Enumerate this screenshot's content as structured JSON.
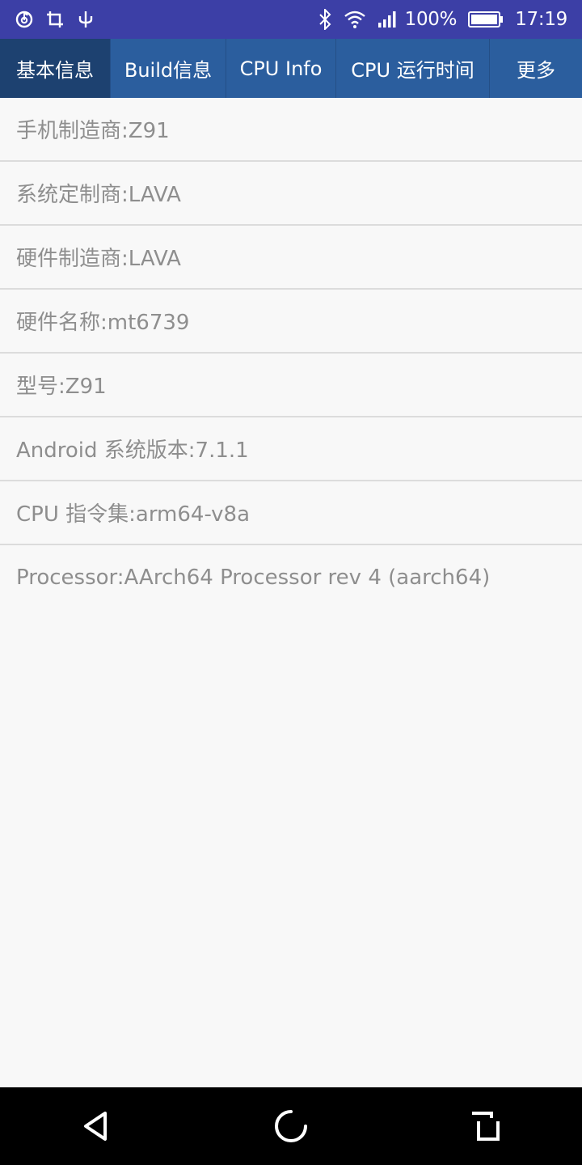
{
  "status_bar": {
    "left_icons": [
      "netease-music-icon",
      "crop-icon",
      "usb-icon"
    ],
    "right_icons": [
      "bluetooth-icon",
      "wifi-icon",
      "signal-icon",
      "battery-icon"
    ],
    "battery_percent": "100%",
    "time": "17:19",
    "battery_level": 1.0
  },
  "tabs": [
    {
      "label": "基本信息",
      "active": true
    },
    {
      "label": "Build信息",
      "active": false
    },
    {
      "label": "CPU Info",
      "active": false
    },
    {
      "label": "CPU 运行时间",
      "active": false
    },
    {
      "label": "更多",
      "active": false
    }
  ],
  "info_rows": [
    "手机制造商:Z91",
    "系统定制商:LAVA",
    "硬件制造商:LAVA",
    "硬件名称:mt6739",
    "型号:Z91",
    "Android 系统版本:7.1.1",
    "CPU 指令集:arm64-v8a",
    "Processor:AArch64 Processor rev 4 (aarch64)"
  ],
  "nav_bar": {
    "buttons": [
      "back-icon",
      "home-icon",
      "recents-icon"
    ]
  },
  "colors": {
    "status_bar": "#3c3fa6",
    "tab_bar": "#2b5e9e",
    "tab_active": "#1d4170",
    "background": "#f8f8f8",
    "row_text": "#8e8e8e"
  }
}
